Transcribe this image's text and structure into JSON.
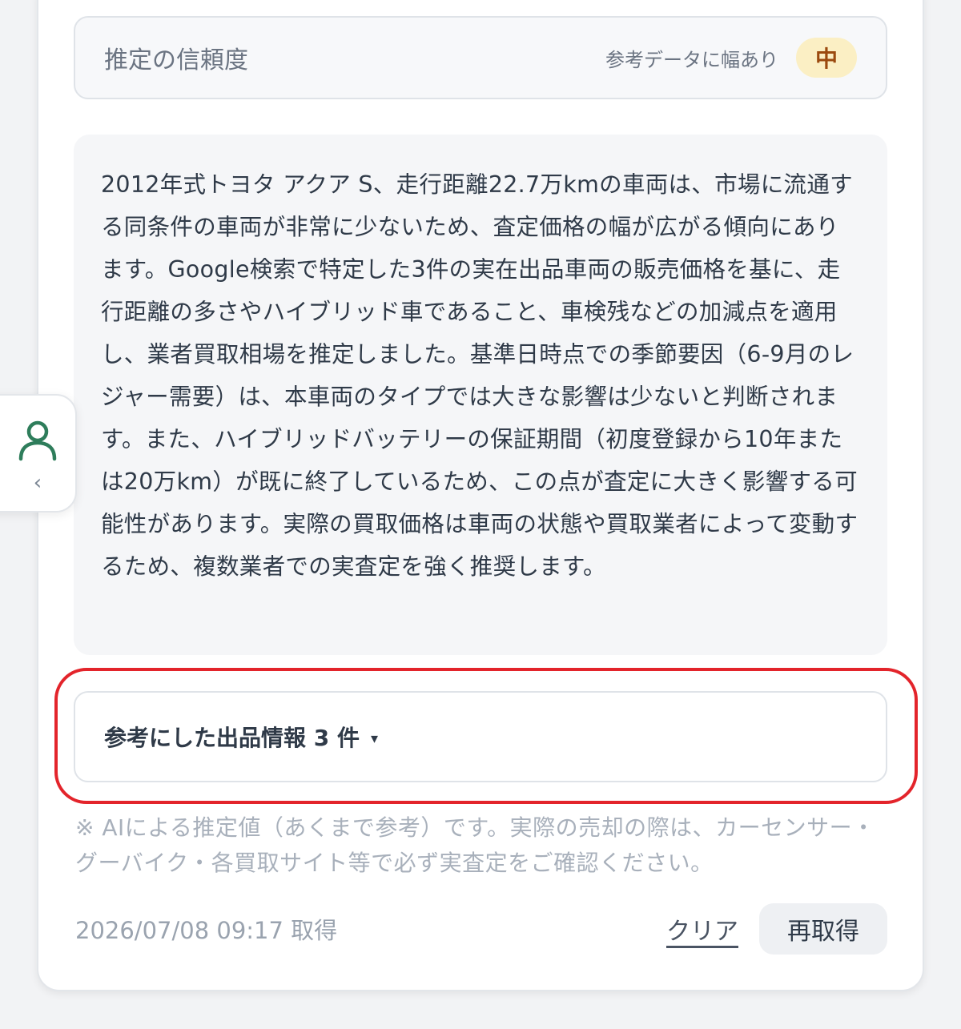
{
  "confidence": {
    "label": "推定の信頼度",
    "note": "参考データに幅あり",
    "level": "中",
    "level_color": "#9b4a0f",
    "level_bg": "#fbefc4"
  },
  "summary": {
    "text": "2012年式トヨタ アクア S、走行距離22.7万kmの車両は、市場に流通する同条件の車両が非常に少ないため、査定価格の幅が広がる傾向にあります。Google検索で特定した3件の実在出品車両の販売価格を基に、走行距離の多さやハイブリッド車であること、車検残などの加減点を適用し、業者買取相場を推定しました。基準日時点での季節要因（6-9月のレジャー需要）は、本車両のタイプでは大きな影響は少ないと判断されます。また、ハイブリッドバッテリーの保証期間（初度登録から10年または20万km）が既に終了しているため、この点が査定に大きく影響する可能性があります。実際の買取価格は車両の状態や買取業者によって変動するため、複数業者での実査定を強く推奨します。"
  },
  "listings": {
    "label": "参考にした出品情報 3 件",
    "caret": "▾"
  },
  "disclaimer": "※ AIによる推定値（あくまで参考）です。実際の売却の際は、カーセンサー・グーバイク・各買取サイト等で必ず実査定をご確認ください。",
  "footer": {
    "timestamp": "2026/07/08 09:17 取得",
    "clear_label": "クリア",
    "refetch_label": "再取得"
  },
  "side_tab": {
    "icon": "person-icon",
    "chevron": "‹"
  },
  "colors": {
    "highlight": "#e3242b",
    "accent_green": "#2e7d5b"
  }
}
